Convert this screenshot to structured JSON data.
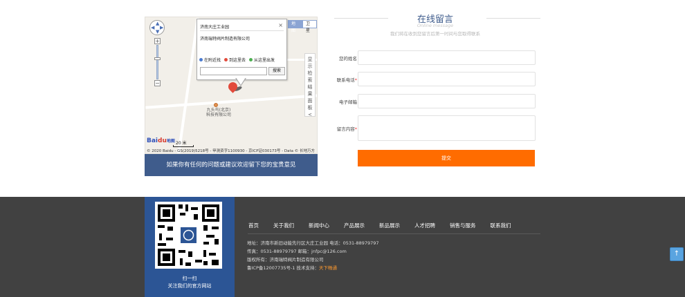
{
  "map": {
    "maptype_map": "地图",
    "maptype_satellite": "卫星",
    "infowindow": {
      "title": "济南大庄工业园",
      "close": "×",
      "body": "济南瑞特阀片制造有限公司",
      "nearby": "在附近找",
      "to_here": "到这里去",
      "from_here": "从这里出发",
      "search_button": "搜索"
    },
    "side_tab": "显示检索结果面板<",
    "poi_label_1": "九头鸟(北京)",
    "poi_label_2": "科技有限公司",
    "logo_a": "Bai",
    "logo_b": "du",
    "logo_c": "地图",
    "scale": "20 米",
    "copyright": "© 2020 Baidu - GS(2019)5218号 - 甲测资字1100930 - 京ICP证030173号 - Data © 长地万方"
  },
  "map_caption": "如果你有任何的问题或建议欢迎留下您的宝贵意见",
  "message": {
    "title": "在线留言",
    "subtitle": "Online message",
    "description": "我们将在收到您留言后第一时间与您取得联系",
    "fields": {
      "name": "您的姓名",
      "phone": "联系电话",
      "email": "电子邮箱",
      "content": "留言内容"
    },
    "required_mark": "*",
    "submit": "提交"
  },
  "footer": {
    "qr_label_1": "扫一扫",
    "qr_label_2": "关注我们的官方网站",
    "nav": [
      "首页",
      "关于我们",
      "新闻中心",
      "产品展示",
      "新品展示",
      "人才招聘",
      "销售与服务",
      "联系我们"
    ],
    "address": "地址：济南市新旧动能先行区大庄工业园  电话：0531-88979797",
    "fax": "传真：0531-88979797 邮箱：jnfpc@126.com",
    "copyright": "版权所有：济南瑞特阀片制造有限公司",
    "icp": "鲁ICP备12007735号-1   技术支持：",
    "tech_support": "天下畅通"
  },
  "back_to_top": "↑"
}
